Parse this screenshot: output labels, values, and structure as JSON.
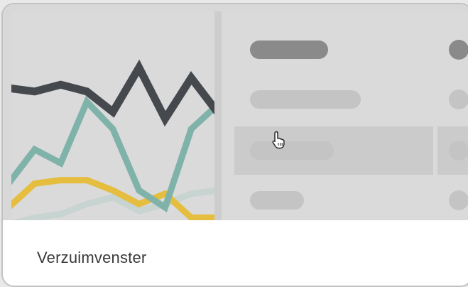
{
  "card": {
    "title": "Verzuimvenster"
  },
  "illustration": {
    "chart_series": [
      {
        "color": "#45484d",
        "values": [
          40,
          39,
          41,
          39,
          33,
          46,
          31,
          43,
          33
        ]
      },
      {
        "color": "#7fb2a9",
        "values": [
          12,
          22,
          18,
          36,
          28,
          10,
          5,
          28,
          35
        ]
      },
      {
        "color": "#e5bd3f",
        "values": [
          5,
          12,
          13,
          13,
          10,
          6,
          9,
          2,
          2
        ]
      },
      {
        "color": "#c7d4d1",
        "values": [
          0,
          2,
          3,
          6,
          8,
          4,
          6,
          9,
          10
        ]
      }
    ],
    "list_rows": [
      {
        "state": "selected"
      },
      {
        "state": "normal"
      },
      {
        "state": "hover"
      },
      {
        "state": "normal"
      }
    ]
  },
  "colors": {
    "background": "#e9e9e9",
    "card": "#ffffff",
    "preview": "#d8d8d8",
    "pill": "#c4c4c4",
    "pill_selected": "#8a8a8a",
    "hover_row": "#cbcbcb"
  },
  "icons": {
    "cursor": "hand-pointer-icon"
  }
}
